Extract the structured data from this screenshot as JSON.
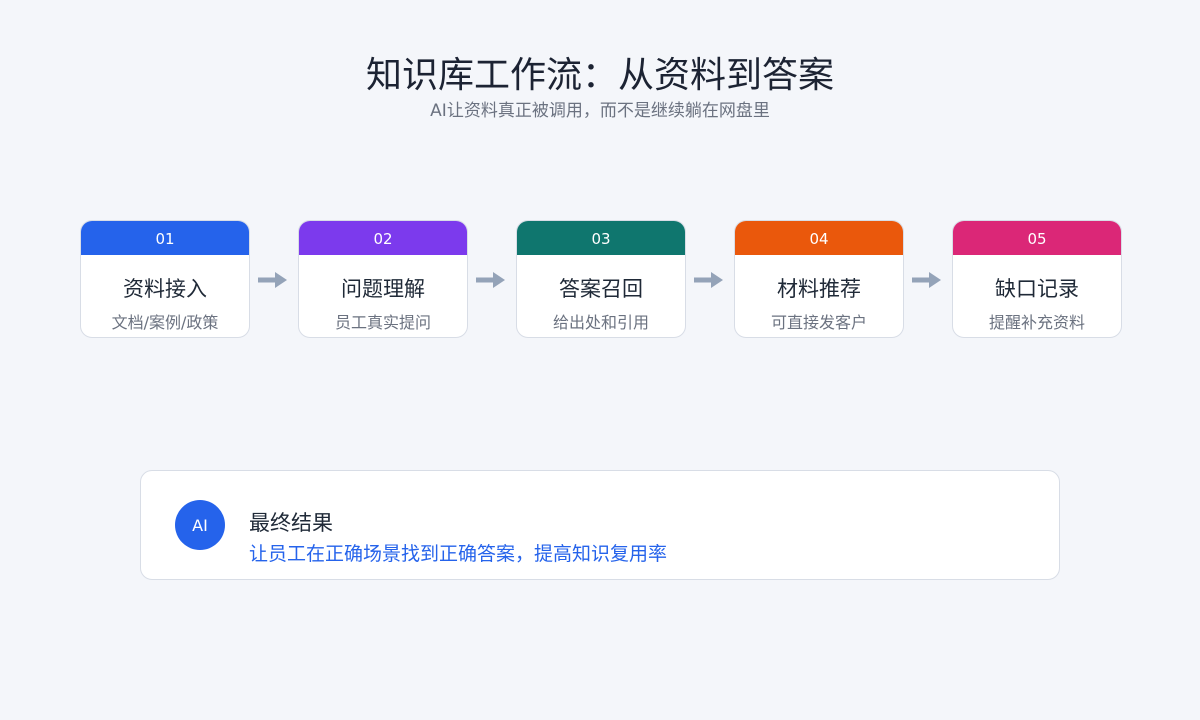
{
  "header": {
    "title": "知识库工作流：从资料到答案",
    "subtitle": "AI让资料真正被调用，而不是继续躺在网盘里"
  },
  "steps": [
    {
      "number": "01",
      "name": "资料接入",
      "desc": "文档/案例/政策",
      "color": "#2563eb"
    },
    {
      "number": "02",
      "name": "问题理解",
      "desc": "员工真实提问",
      "color": "#7c3aed"
    },
    {
      "number": "03",
      "name": "答案召回",
      "desc": "给出处和引用",
      "color": "#0f766e"
    },
    {
      "number": "04",
      "name": "材料推荐",
      "desc": "可直接发客户",
      "color": "#ea580c"
    },
    {
      "number": "05",
      "name": "缺口记录",
      "desc": "提醒补充资料",
      "color": "#db2777"
    }
  ],
  "arrow_icon": "arrow-right-icon",
  "arrow_color": "#94a3b8",
  "result": {
    "badge": "AI",
    "title": "最终结果",
    "text": "让员工在正确场景找到正确答案，提高知识复用率",
    "accent": "#2563eb"
  }
}
